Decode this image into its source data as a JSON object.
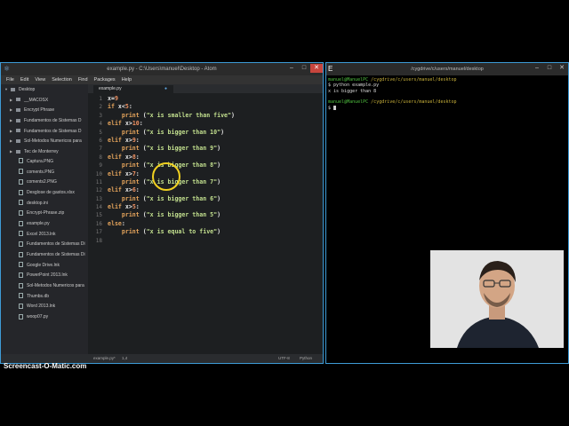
{
  "atom": {
    "title": "example.py - C:\\Users\\manuel\\Desktop - Atom",
    "controls": [
      "–",
      "□",
      "✕"
    ],
    "menu": [
      "File",
      "Edit",
      "View",
      "Selection",
      "Find",
      "Packages",
      "Help"
    ],
    "tree": [
      {
        "label": "Desktop",
        "type": "root"
      },
      {
        "label": "__MACOSX",
        "type": "folder"
      },
      {
        "label": "Encrypt Phrase",
        "type": "folder"
      },
      {
        "label": "Fundamentos de Sistemas D",
        "type": "folder"
      },
      {
        "label": "Fundamentos de Sistemas D",
        "type": "folder"
      },
      {
        "label": "Sol-Metodos Numericos para",
        "type": "folder"
      },
      {
        "label": "Tec de Monterrey",
        "type": "folder"
      },
      {
        "label": "Captura.PNG",
        "type": "file"
      },
      {
        "label": "coments.PNG",
        "type": "file"
      },
      {
        "label": "coments2.PNG",
        "type": "file"
      },
      {
        "label": "Desglose de gastos.xlsx",
        "type": "file"
      },
      {
        "label": "desktop.ini",
        "type": "file"
      },
      {
        "label": "Encrypt-Phrase.zip",
        "type": "file"
      },
      {
        "label": "example.py",
        "type": "file"
      },
      {
        "label": "Excel 2013.lnk",
        "type": "file"
      },
      {
        "label": "Fundamentos de Sistemas Di",
        "type": "file"
      },
      {
        "label": "Fundamentos de Sistemas Di",
        "type": "file"
      },
      {
        "label": "Google Drive.lnk",
        "type": "file"
      },
      {
        "label": "PowerPoint 2013.lnk",
        "type": "file"
      },
      {
        "label": "Sol-Metodos Numericos para",
        "type": "file"
      },
      {
        "label": "Thumbs.db",
        "type": "file"
      },
      {
        "label": "Word 2013.lnk",
        "type": "file"
      },
      {
        "label": "woop07.py",
        "type": "file"
      }
    ],
    "tab_label": "example.py",
    "line_numbers": [
      "1",
      "2",
      "3",
      "4",
      "5",
      "6",
      "7",
      "8",
      "9",
      "10",
      "11",
      "12",
      "13",
      "14",
      "15",
      "16",
      "17",
      "18"
    ],
    "code": [
      "x=9",
      "if x<5:",
      "    print (\"x is smaller than five\")",
      "elif x>10:",
      "    print (\"x is bigger than 10\")",
      "elif x>9:",
      "    print (\"x is bigger than 9\")",
      "elif x>8:",
      "    print (\"x is bigger than 8\")",
      "elif x>7:",
      "    print (\"x is bigger than 7\")",
      "elif x>6:",
      "    print (\"x is bigger than 6\")",
      "elif x>5:",
      "    print (\"x is bigger than 5\")",
      "else:",
      "    print (\"x is equal to five\")",
      ""
    ],
    "status": {
      "file": "example.py*",
      "position": "1,4",
      "encoding": "UTF-8",
      "grammar": "Python"
    }
  },
  "terminal": {
    "title": "/cygdrive/c/users/manuel/desktop",
    "controls": [
      "–",
      "□",
      "✕"
    ],
    "prompt1_user": "manuel@ManuelPC",
    "prompt1_path": "/cygdrive/c/users/manuel/desktop",
    "cmd": "$ python example.py",
    "output": "x is bigger than 8",
    "prompt2_user": "manuel@ManuelPC",
    "prompt2_path": "/cygdrive/c/users/manuel/desktop",
    "prompt_end": "$ "
  },
  "watermark": "Screencast-O-Matic.com",
  "colors": {
    "accent": "#3e9bd6",
    "keyword": "#e3a35b",
    "string": "#c2df8e",
    "user": "#4fbf3f",
    "path": "#c9b13a"
  }
}
